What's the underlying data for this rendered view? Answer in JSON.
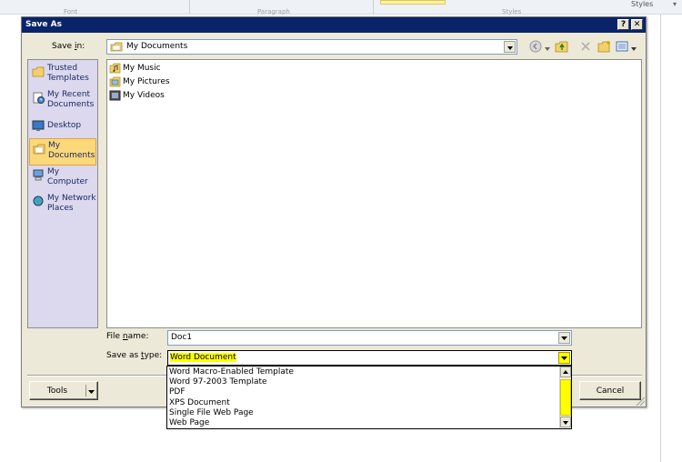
{
  "background": {
    "ribbon_groups": [
      "Font",
      "Paragraph",
      "Styles"
    ],
    "styles_label": "Styles",
    "styles_caret": "▾"
  },
  "dialog": {
    "title": "Save As",
    "help_button": "?",
    "close_button": "✕",
    "save_in_label": "Save in:",
    "save_in_value": "My Documents",
    "file_name_label": "File name:",
    "file_name_value": "Doc1",
    "save_as_type_label": "Save as type:",
    "save_as_type_value": "Word Document",
    "tools_button": "Tools",
    "cancel_button": "Cancel"
  },
  "places": [
    {
      "label": "Trusted Templates",
      "icon": "folder-icon",
      "selected": false
    },
    {
      "label": "My Recent Documents",
      "icon": "recent-documents-icon",
      "selected": false
    },
    {
      "label": "Desktop",
      "icon": "desktop-icon",
      "selected": false
    },
    {
      "label": "My Documents",
      "icon": "my-documents-icon",
      "selected": true
    },
    {
      "label": "My Computer",
      "icon": "computer-icon",
      "selected": false
    },
    {
      "label": "My Network Places",
      "icon": "network-icon",
      "selected": false
    }
  ],
  "files": [
    {
      "name": "My Music",
      "icon": "music-folder-icon"
    },
    {
      "name": "My Pictures",
      "icon": "pictures-folder-icon"
    },
    {
      "name": "My Videos",
      "icon": "videos-folder-icon"
    }
  ],
  "file_types": [
    "Word Macro-Enabled Template",
    "Word 97-2003 Template",
    "PDF",
    "XPS Document",
    "Single File Web Page",
    "Web Page"
  ],
  "colors": {
    "titlebar": "#0a246a",
    "dialog_bg": "#ece9d8",
    "places_bg": "#dcd8ee",
    "selected_place": "#fbd87a",
    "highlight": "#ffff00"
  }
}
